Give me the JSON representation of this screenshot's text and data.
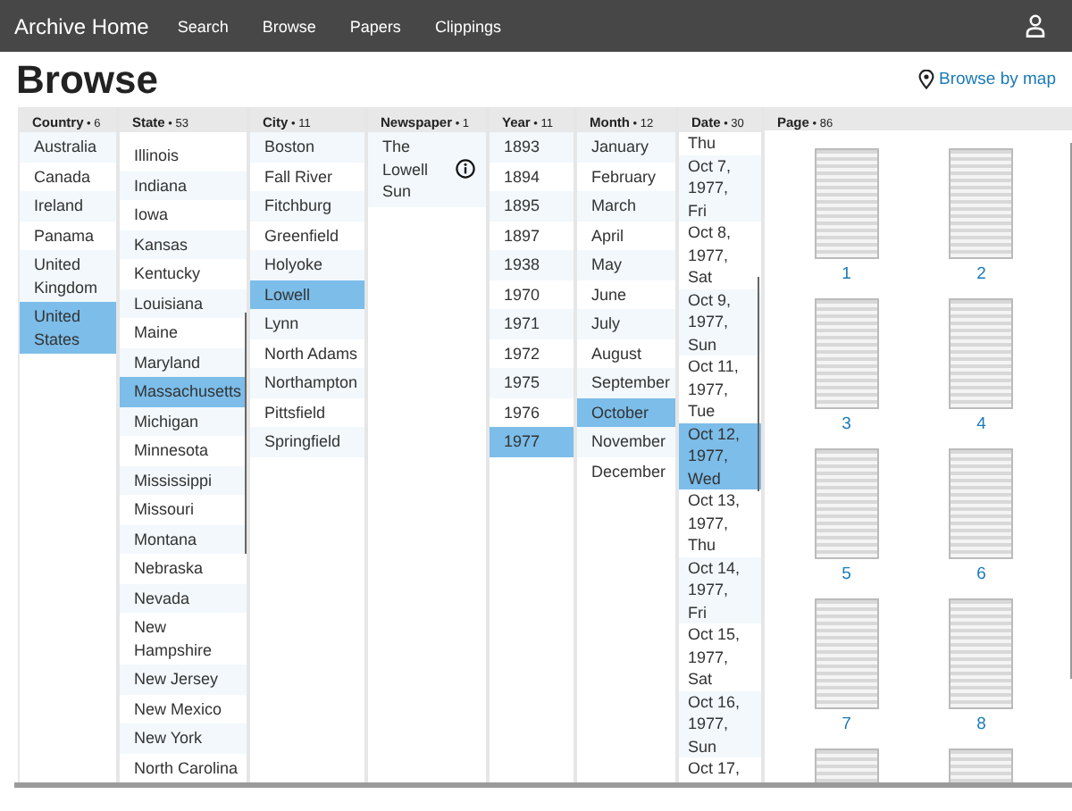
{
  "nav": {
    "brand": "Archive Home",
    "links": [
      {
        "label": "Search"
      },
      {
        "label": "Browse"
      },
      {
        "label": "Papers"
      },
      {
        "label": "Clippings"
      }
    ]
  },
  "title": "Browse",
  "map_link": "Browse by map",
  "columns": [
    {
      "kind": "list",
      "title": "Country",
      "separator": "•",
      "count": "6",
      "items": [
        {
          "label": "Australia",
          "selected": false
        },
        {
          "label": "Canada",
          "selected": false
        },
        {
          "label": "Ireland",
          "selected": false
        },
        {
          "label": "Panama",
          "selected": false
        },
        {
          "label": "United Kingdom",
          "selected": false
        },
        {
          "label": "United States",
          "selected": true
        }
      ]
    },
    {
      "kind": "list",
      "title": "State",
      "separator": "•",
      "count": "53",
      "items": [
        {
          "label": "Illinois",
          "selected": false
        },
        {
          "label": "Indiana",
          "selected": false
        },
        {
          "label": "Iowa",
          "selected": false
        },
        {
          "label": "Kansas",
          "selected": false
        },
        {
          "label": "Kentucky",
          "selected": false
        },
        {
          "label": "Louisiana",
          "selected": false
        },
        {
          "label": "Maine",
          "selected": false
        },
        {
          "label": "Maryland",
          "selected": false
        },
        {
          "label": "Massachusetts",
          "selected": true
        },
        {
          "label": "Michigan",
          "selected": false
        },
        {
          "label": "Minnesota",
          "selected": false
        },
        {
          "label": "Mississippi",
          "selected": false
        },
        {
          "label": "Missouri",
          "selected": false
        },
        {
          "label": "Montana",
          "selected": false
        },
        {
          "label": "Nebraska",
          "selected": false
        },
        {
          "label": "Nevada",
          "selected": false
        },
        {
          "label": "New Hampshire",
          "selected": false
        },
        {
          "label": "New Jersey",
          "selected": false
        },
        {
          "label": "New Mexico",
          "selected": false
        },
        {
          "label": "New York",
          "selected": false
        },
        {
          "label": "North Carolina",
          "selected": false
        }
      ]
    },
    {
      "kind": "list",
      "title": "City",
      "separator": "•",
      "count": "11",
      "items": [
        {
          "label": "Boston",
          "selected": false
        },
        {
          "label": "Fall River",
          "selected": false
        },
        {
          "label": "Fitchburg",
          "selected": false
        },
        {
          "label": "Greenfield",
          "selected": false
        },
        {
          "label": "Holyoke",
          "selected": false
        },
        {
          "label": "Lowell",
          "selected": true
        },
        {
          "label": "Lynn",
          "selected": false
        },
        {
          "label": "North Adams",
          "selected": false
        },
        {
          "label": "Northampton",
          "selected": false
        },
        {
          "label": "Pittsfield",
          "selected": false
        },
        {
          "label": "Springfield",
          "selected": false
        }
      ]
    },
    {
      "kind": "list",
      "title": "Newspaper",
      "separator": "•",
      "count": "1",
      "items": [
        {
          "label": "The Lowell Sun",
          "selected": false,
          "info": true
        }
      ]
    },
    {
      "kind": "list",
      "title": "Year",
      "separator": "•",
      "count": "11",
      "items": [
        {
          "label": "1893",
          "selected": false
        },
        {
          "label": "1894",
          "selected": false
        },
        {
          "label": "1895",
          "selected": false
        },
        {
          "label": "1897",
          "selected": false
        },
        {
          "label": "1938",
          "selected": false
        },
        {
          "label": "1970",
          "selected": false
        },
        {
          "label": "1971",
          "selected": false
        },
        {
          "label": "1972",
          "selected": false
        },
        {
          "label": "1975",
          "selected": false
        },
        {
          "label": "1976",
          "selected": false
        },
        {
          "label": "1977",
          "selected": true
        }
      ]
    },
    {
      "kind": "list",
      "title": "Month",
      "separator": "•",
      "count": "12",
      "items": [
        {
          "label": "January",
          "selected": false
        },
        {
          "label": "February",
          "selected": false
        },
        {
          "label": "March",
          "selected": false
        },
        {
          "label": "April",
          "selected": false
        },
        {
          "label": "May",
          "selected": false
        },
        {
          "label": "June",
          "selected": false
        },
        {
          "label": "July",
          "selected": false
        },
        {
          "label": "August",
          "selected": false
        },
        {
          "label": "September",
          "selected": false
        },
        {
          "label": "October",
          "selected": true
        },
        {
          "label": "November",
          "selected": false
        },
        {
          "label": "December",
          "selected": false
        }
      ]
    },
    {
      "kind": "dates",
      "title": "Date",
      "separator": "•",
      "count": "30",
      "items": [
        {
          "label": "Thu",
          "selected": false
        },
        {
          "label": "Oct 7, 1977, Fri",
          "selected": false
        },
        {
          "label": "Oct 8, 1977, Sat",
          "selected": false
        },
        {
          "label": "Oct 9, 1977, Sun",
          "selected": false
        },
        {
          "label": "Oct 11, 1977, Tue",
          "selected": false
        },
        {
          "label": "Oct 12, 1977, Wed",
          "selected": true
        },
        {
          "label": "Oct 13, 1977, Thu",
          "selected": false
        },
        {
          "label": "Oct 14, 1977, Fri",
          "selected": false
        },
        {
          "label": "Oct 15, 1977, Sat",
          "selected": false
        },
        {
          "label": "Oct 16, 1977, Sun",
          "selected": false
        },
        {
          "label": "Oct 17,",
          "selected": false
        }
      ]
    },
    {
      "kind": "pages",
      "title": "Page",
      "separator": "•",
      "count": "86",
      "items": [
        {
          "kind": "page",
          "label": "1"
        },
        {
          "kind": "page",
          "label": "2"
        },
        {
          "kind": "page",
          "label": "3"
        },
        {
          "kind": "page",
          "label": "4"
        },
        {
          "kind": "page",
          "label": "5"
        },
        {
          "kind": "page",
          "label": "6"
        },
        {
          "kind": "page",
          "label": "7"
        },
        {
          "kind": "page",
          "label": "8"
        },
        {
          "kind": "cut"
        },
        {
          "kind": "cut"
        }
      ]
    }
  ]
}
